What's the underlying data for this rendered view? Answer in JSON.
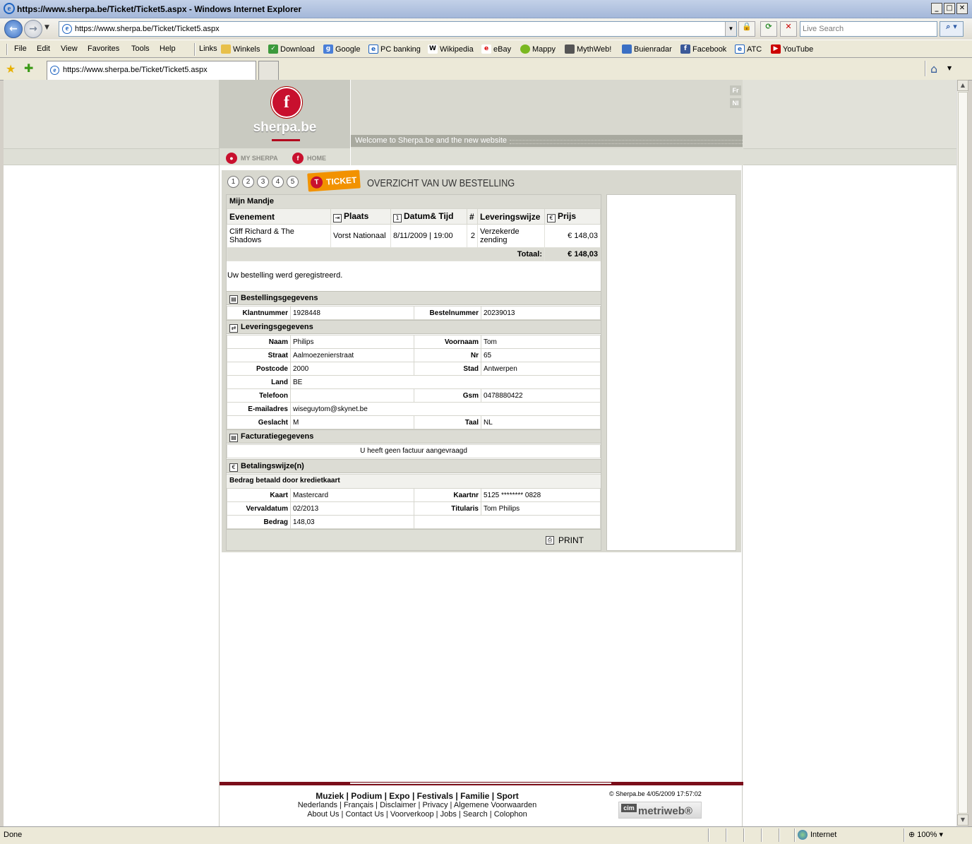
{
  "browser": {
    "title": "https://www.sherpa.be/Ticket/Ticket5.aspx - Windows Internet Explorer",
    "address": "https://www.sherpa.be/Ticket/Ticket5.aspx",
    "search_placeholder": "Live Search",
    "tab_title": "https://www.sherpa.be/Ticket/Ticket5.aspx",
    "menu": [
      "File",
      "Edit",
      "View",
      "Favorites",
      "Tools",
      "Help"
    ],
    "links_label": "Links",
    "links": [
      "Winkels",
      "Download",
      "Google",
      "PC banking",
      "Wikipedia",
      "eBay",
      "Mappy",
      "MythWeb!",
      "Buienradar",
      "Facebook",
      "ATC",
      "YouTube"
    ],
    "status": "Done",
    "zone": "Internet",
    "zoom": "100%"
  },
  "site": {
    "logo": "sherpa.be",
    "lang_fr": "Fr",
    "lang_nl": "Nl",
    "welcome": "Welcome to Sherpa.be and the new website",
    "nav": {
      "my_sherpa": "MY SHERPA",
      "home": "HOME"
    },
    "steps": [
      "1",
      "2",
      "3",
      "4",
      "5"
    ],
    "ticket_badge": "TICKET",
    "page_title": "OVERZICHT VAN UW BESTELLING"
  },
  "cart": {
    "title": "Mijn Mandje",
    "headers": {
      "event": "Evenement",
      "place": "Plaats",
      "datetime": "Datum& Tijd",
      "qty": "#",
      "delivery": "Leveringswijze",
      "price": "Prijs"
    },
    "row": {
      "event": "Cliff Richard & The Shadows",
      "place": "Vorst Nationaal",
      "datetime": "8/11/2009 | 19:00",
      "qty": "2",
      "delivery": "Verzekerde zending",
      "price": "€ 148,03"
    },
    "total_label": "Totaal:",
    "total_value": "€ 148,03"
  },
  "message": "Uw bestelling werd geregistreerd.",
  "order": {
    "title": "Bestellingsgegevens",
    "klantnummer_label": "Klantnummer",
    "klantnummer": "1928448",
    "bestelnummer_label": "Bestelnummer",
    "bestelnummer": "20239013"
  },
  "delivery": {
    "title": "Leveringsgegevens",
    "naam_label": "Naam",
    "naam": "Philips",
    "voornaam_label": "Voornaam",
    "voornaam": "Tom",
    "straat_label": "Straat",
    "straat": "Aalmoezenierstraat",
    "nr_label": "Nr",
    "nr": "65",
    "postcode_label": "Postcode",
    "postcode": "2000",
    "stad_label": "Stad",
    "stad": "Antwerpen",
    "land_label": "Land",
    "land": "BE",
    "telefoon_label": "Telefoon",
    "telefoon": "",
    "gsm_label": "Gsm",
    "gsm": "0478880422",
    "email_label": "E-mailadres",
    "email": "wiseguytom@skynet.be",
    "geslacht_label": "Geslacht",
    "geslacht": "M",
    "taal_label": "Taal",
    "taal": "NL"
  },
  "invoice": {
    "title": "Facturatiegegevens",
    "text": "U heeft geen factuur aangevraagd"
  },
  "payment": {
    "title": "Betalingswijze(n)",
    "subtitle": "Bedrag betaald door kredietkaart",
    "kaart_label": "Kaart",
    "kaart": "Mastercard",
    "kaartnr_label": "Kaartnr",
    "kaartnr": "5125 ******** 0828",
    "vervaldatum_label": "Vervaldatum",
    "vervaldatum": "02/2013",
    "titularis_label": "Titularis",
    "titularis": "Tom Philips",
    "bedrag_label": "Bedrag",
    "bedrag": "148,03"
  },
  "print_label": "PRINT",
  "footer": {
    "main_links": [
      "Muziek",
      "Podium",
      "Expo",
      "Festivals",
      "Familie",
      "Sport"
    ],
    "line2": [
      "Nederlands",
      "Français",
      "Disclaimer",
      "Privacy",
      "Algemene Voorwaarden"
    ],
    "line3": [
      "About Us",
      "Contact Us",
      "Voorverkoop",
      "Jobs",
      "Search",
      "Colophon"
    ],
    "copyright": "© Sherpa.be 4/05/2009 17:57:02",
    "cim": "cim",
    "metriweb": "metriweb®"
  }
}
